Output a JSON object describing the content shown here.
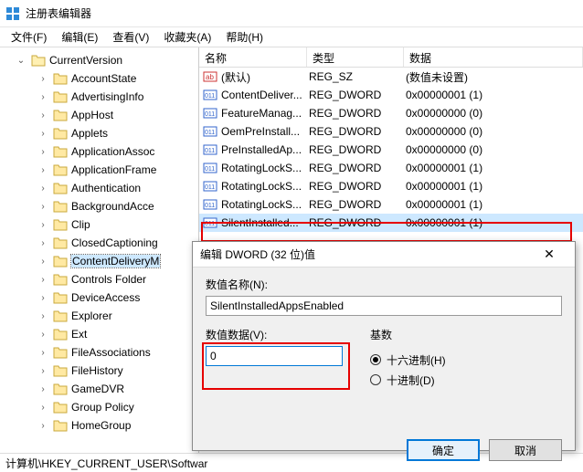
{
  "window": {
    "title": "注册表编辑器"
  },
  "menu": {
    "file": "文件(F)",
    "edit": "编辑(E)",
    "view": "查看(V)",
    "fav": "收藏夹(A)",
    "help": "帮助(H)"
  },
  "tree": {
    "root": "CurrentVersion",
    "items": [
      "AccountState",
      "AdvertisingInfo",
      "AppHost",
      "Applets",
      "ApplicationAssoc",
      "ApplicationFrame",
      "Authentication",
      "BackgroundAcce",
      "Clip",
      "ClosedCaptioning",
      "ContentDeliveryM",
      "Controls Folder",
      "DeviceAccess",
      "Explorer",
      "Ext",
      "FileAssociations",
      "FileHistory",
      "GameDVR",
      "Group Policy",
      "HomeGroup"
    ],
    "selected_index": 10
  },
  "list": {
    "headers": {
      "name": "名称",
      "type": "类型",
      "data": "数据"
    },
    "rows": [
      {
        "icon": "str",
        "name": "(默认)",
        "type": "REG_SZ",
        "data": "(数值未设置)"
      },
      {
        "icon": "bin",
        "name": "ContentDeliver...",
        "type": "REG_DWORD",
        "data": "0x00000001 (1)"
      },
      {
        "icon": "bin",
        "name": "FeatureManag...",
        "type": "REG_DWORD",
        "data": "0x00000000 (0)"
      },
      {
        "icon": "bin",
        "name": "OemPreInstall...",
        "type": "REG_DWORD",
        "data": "0x00000000 (0)"
      },
      {
        "icon": "bin",
        "name": "PreInstalledAp...",
        "type": "REG_DWORD",
        "data": "0x00000000 (0)"
      },
      {
        "icon": "bin",
        "name": "RotatingLockS...",
        "type": "REG_DWORD",
        "data": "0x00000001 (1)"
      },
      {
        "icon": "bin",
        "name": "RotatingLockS...",
        "type": "REG_DWORD",
        "data": "0x00000001 (1)"
      },
      {
        "icon": "bin",
        "name": "RotatingLockS...",
        "type": "REG_DWORD",
        "data": "0x00000001 (1)"
      },
      {
        "icon": "bin",
        "name": "SilentInstalled...",
        "type": "REG_DWORD",
        "data": "0x00000001 (1)"
      }
    ],
    "selected_index": 8
  },
  "dialog": {
    "title": "编辑 DWORD (32 位)值",
    "name_label": "数值名称(N):",
    "name_value": "SilentInstalledAppsEnabled",
    "data_label": "数值数据(V):",
    "data_value": "0",
    "base_label": "基数",
    "radio_hex": "十六进制(H)",
    "radio_dec": "十进制(D)",
    "ok": "确定",
    "cancel": "取消"
  },
  "statusbar": {
    "path": "计算机\\HKEY_CURRENT_USER\\Softwar"
  }
}
